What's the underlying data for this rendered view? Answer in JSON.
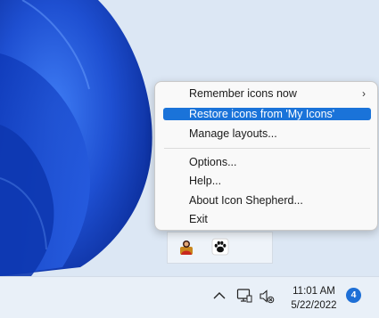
{
  "menu": {
    "items": [
      {
        "label": "Remember icons now",
        "submenu": true
      },
      {
        "label": "Restore icons from 'My Icons'",
        "selected": true
      },
      {
        "label": "Manage layouts..."
      },
      {
        "label": "Options..."
      },
      {
        "label": "Help..."
      },
      {
        "label": "About Icon Shepherd..."
      },
      {
        "label": "Exit"
      }
    ],
    "submenu_arrow": "›"
  },
  "tray_flyout": {
    "icons": [
      "person-app-icon",
      "paw-icon"
    ]
  },
  "taskbar": {
    "icons": [
      "chevron-up-icon",
      "network-icon",
      "speaker-muted-icon"
    ],
    "time": "11:01 AM",
    "date": "5/22/2022",
    "notification_count": "4"
  },
  "colors": {
    "accent": "#1a73d9",
    "wallpaper_bg": "#dce7f4",
    "wallpaper_bloom": "#1f4fd6",
    "taskbar": "#e9f0f8"
  }
}
